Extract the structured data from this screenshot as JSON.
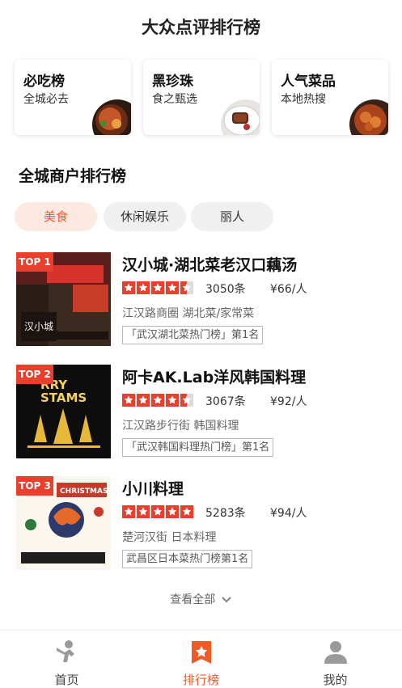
{
  "header": {
    "title": "大众点评排行榜"
  },
  "feature_cards": [
    {
      "title": "必吃榜",
      "subtitle": "全城必去",
      "image_icon": "dish-photo"
    },
    {
      "title": "黑珍珠",
      "subtitle": "食之甄选",
      "image_icon": "steak-photo"
    },
    {
      "title": "人气菜品",
      "subtitle": "本地热搜",
      "image_icon": "crayfish-photo"
    }
  ],
  "section": {
    "title": "全城商户排行榜"
  },
  "filter_tabs": [
    {
      "label": "美食",
      "active": true
    },
    {
      "label": "休闲娱乐",
      "active": false
    },
    {
      "label": "丽人",
      "active": false
    }
  ],
  "colors": {
    "accent": "#f15a24",
    "star": "#e8402c",
    "tag": "#e8402c"
  },
  "merchants": [
    {
      "rank_tag": "TOP 1",
      "name": "汉小城·湖北菜老汉口藕汤",
      "rating": 4.5,
      "reviews": "3050条",
      "price": "¥66/人",
      "location": "江汉路商圈 湖北菜/家常菜",
      "badge": "「武汉湖北菜热门榜」第1名",
      "photo_text": "汉小城"
    },
    {
      "rank_tag": "TOP 2",
      "name": "阿卡AK.Lab洋风韩国料理",
      "rating": 4.5,
      "reviews": "3067条",
      "price": "¥92/人",
      "location": "江汉路步行街 韩国料理",
      "badge": "「武汉韩国料理热门榜」第1名",
      "photo_text": "RRY\nSTAMS"
    },
    {
      "rank_tag": "TOP 3",
      "name": "小川料理",
      "rating": 5,
      "reviews": "5283条",
      "price": "¥94/人",
      "location": "楚河汉街 日本料理",
      "badge": "武昌区日本菜热门榜第1名",
      "photo_text": "CHRISTMAS"
    }
  ],
  "see_all": {
    "label": "查看全部"
  },
  "bottom_tabs": [
    {
      "label": "首页",
      "icon": "home-person-icon",
      "active": false
    },
    {
      "label": "排行榜",
      "icon": "ranking-badge-icon",
      "active": true
    },
    {
      "label": "我的",
      "icon": "profile-icon",
      "active": false
    }
  ]
}
